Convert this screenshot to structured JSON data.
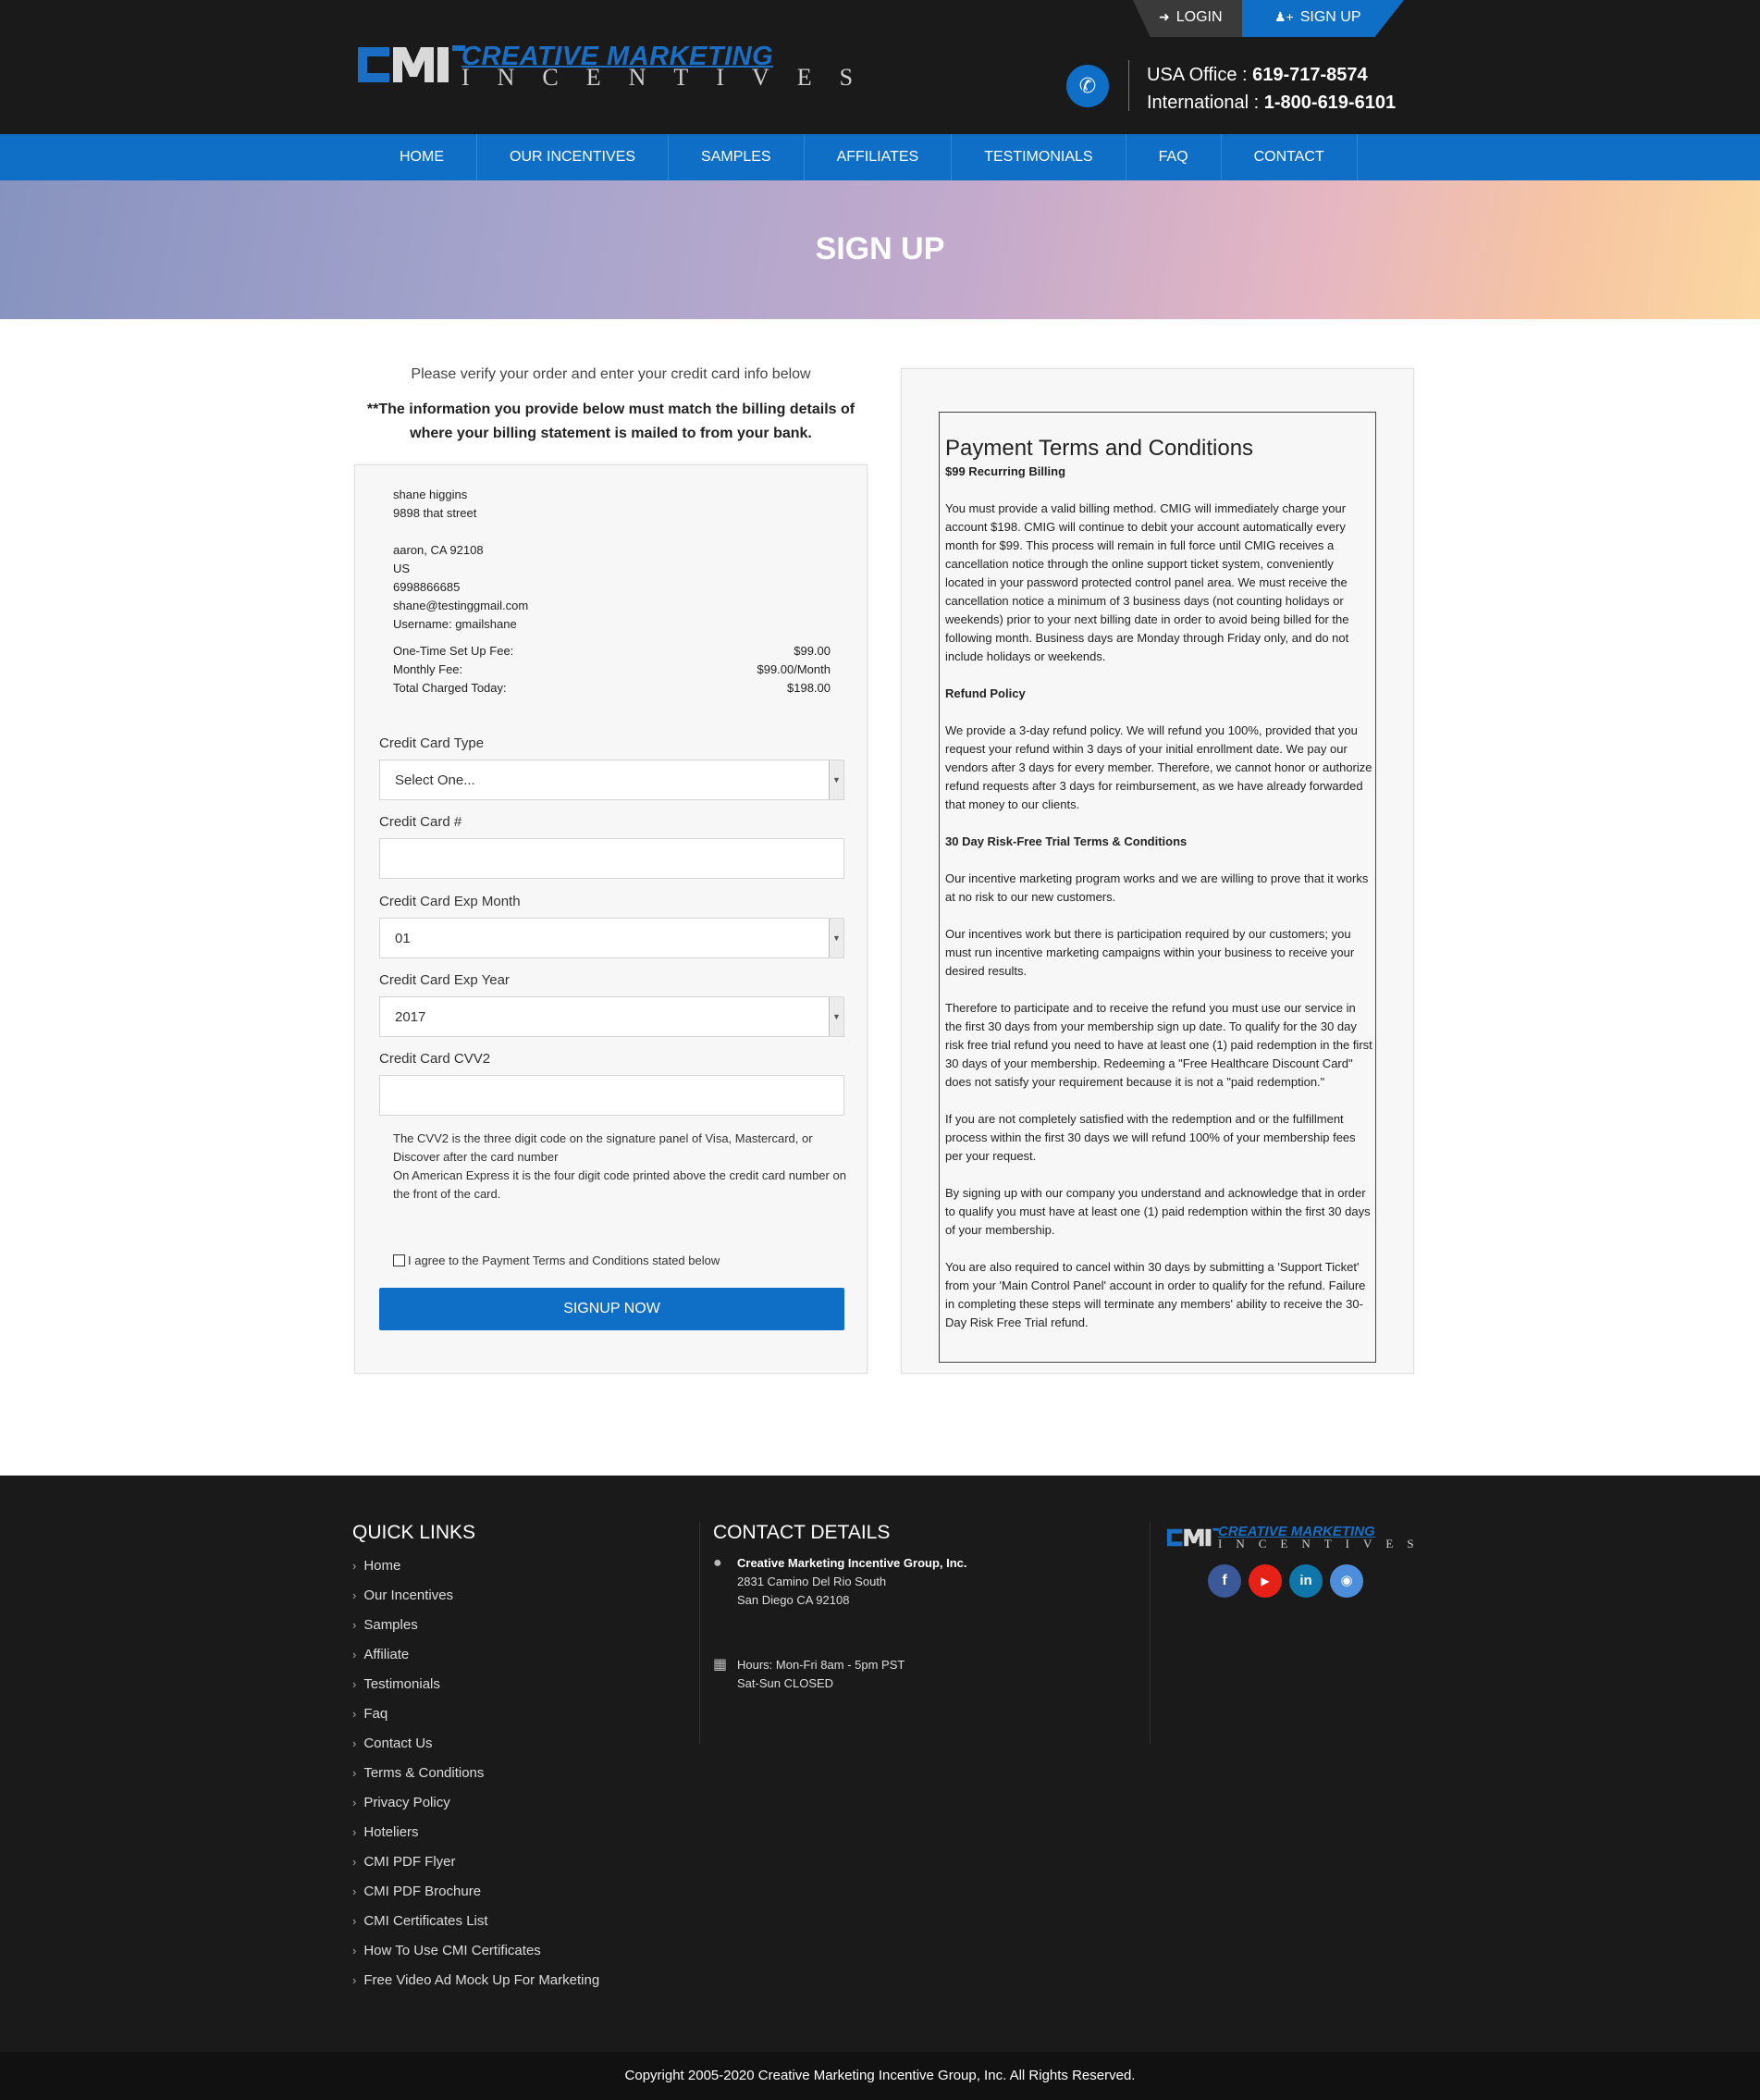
{
  "header": {
    "logo_line1": "CREATIVE MARKETING",
    "logo_line2": "INCENTIVES",
    "login": "LOGIN",
    "signup": "SIGN UP",
    "usa_label": "USA Office : ",
    "usa_phone": "619-717-8574",
    "intl_label": "International : ",
    "intl_phone": "1-800-619-6101"
  },
  "nav": [
    "HOME",
    "OUR INCENTIVES",
    "SAMPLES",
    "AFFILIATES",
    "TESTIMONIALS",
    "FAQ",
    "CONTACT"
  ],
  "banner": {
    "title": "SIGN UP"
  },
  "intro": {
    "line1": "Please verify your order and enter your credit card info below",
    "line2": "**The information you provide below must match the billing details of where your billing statement is mailed to from your bank."
  },
  "order": {
    "name": "shane higgins",
    "street": "9898 that street",
    "city": "aaron, CA 92108",
    "country": "US",
    "phone": "6998866685",
    "email": "shane@testinggmail.com",
    "username": "Username: gmailshane",
    "fees": [
      {
        "label": "One-Time Set Up Fee:",
        "value": "$99.00"
      },
      {
        "label": "Monthly Fee:",
        "value": "$99.00/Month"
      },
      {
        "label": "Total Charged Today:",
        "value": "$198.00"
      }
    ]
  },
  "form": {
    "cc_type_label": "Credit Card Type",
    "cc_type_value": "Select One...",
    "cc_number_label": "Credit Card #",
    "cc_number_value": "",
    "exp_month_label": "Credit Card Exp Month",
    "exp_month_value": "01",
    "exp_year_label": "Credit Card Exp Year",
    "exp_year_value": "2017",
    "cvv_label": "Credit Card CVV2",
    "cvv_value": "",
    "cvv_help1": "The CVV2 is the three digit code on the signature panel of Visa, Mastercard, or Discover after the card number",
    "cvv_help2": "On American Express it is the four digit code printed above the credit card number on the front of the card.",
    "agree": "I agree to the Payment Terms and Conditions stated below",
    "submit": "SIGNUP NOW"
  },
  "terms": {
    "title": "Payment Terms and Conditions",
    "h1": "$99 Recurring Billing",
    "p1": "You must provide a valid billing method. CMIG will immediately charge your account $198. CMIG will continue to debit your account automatically every month for $99. This process will remain in full force until CMIG receives a cancellation notice through the online support ticket system, conveniently located in your password protected control panel area. We must receive the cancellation notice a minimum of 3 business days (not counting holidays or weekends) prior to your next billing date in order to avoid being billed for the following month. Business days are Monday through Friday only, and do not include holidays or weekends.",
    "h2": "Refund Policy",
    "p2": "We provide a 3-day refund policy. We will refund you 100%, provided that you request your refund within 3 days of your initial enrollment date. We pay our vendors after 3 days for every member. Therefore, we cannot honor or authorize refund requests after 3 days for reimbursement, as we have already forwarded that money to our clients.",
    "h3": "30 Day Risk-Free Trial Terms & Conditions",
    "p3": "Our incentive marketing program works and we are willing to prove that it works at no risk to our new customers.",
    "p4": "Our incentives work but there is participation required by our customers; you must run incentive marketing campaigns within your business to receive your desired results.",
    "p5": "Therefore to participate and to receive the refund you must use our service in the first 30 days from your membership sign up date. To qualify for the 30 day risk free trial refund you need to have at least one (1) paid redemption in the first 30 days of your membership. Redeeming a \"Free Healthcare Discount Card\" does not satisfy your requirement because it is not a \"paid redemption.\"",
    "p6": "If you are not completely satisfied with the redemption and or the fulfillment process within the first 30 days we will refund 100% of your membership fees per your request.",
    "p7": "By signing up with our company you understand and acknowledge that in order to qualify you must have at least one (1) paid redemption within the first 30 days of your membership.",
    "p8": "You are also required to cancel within 30 days by submitting a 'Support Ticket' from your 'Main Control Panel' account in order to qualify for the refund. Failure in completing these steps will terminate any members' ability to receive the 30-Day Risk Free Trial refund."
  },
  "footer": {
    "quick_links_title": "QUICK LINKS",
    "quick_links": [
      "Home",
      "Our Incentives",
      "Samples",
      "Affiliate",
      "Testimonials",
      "Faq",
      "Contact Us",
      "Terms & Conditions",
      "Privacy Policy",
      "Hoteliers",
      "CMI PDF Flyer",
      "CMI PDF Brochure",
      "CMI Certificates List",
      "How To Use CMI Certificates",
      "Free Video Ad Mock Up For Marketing"
    ],
    "contact_title": "CONTACT DETAILS",
    "company": "Creative Marketing Incentive Group, Inc.",
    "address1": "2831 Camino Del Rio South",
    "address2": "San Diego CA 92108",
    "hours1": "Hours: Mon-Fri 8am - 5pm PST",
    "hours2": "Sat-Sun CLOSED",
    "copyright": "Copyright 2005-2020 Creative Marketing Incentive Group, Inc. All Rights Reserved."
  },
  "colors": {
    "brand_blue": "#0f6fc6",
    "dark_bg": "#1a1a1a"
  },
  "icons": [
    "login-icon",
    "user-plus-icon",
    "phone-icon",
    "chevron-right-icon",
    "map-marker-icon",
    "calendar-icon",
    "facebook-icon",
    "youtube-icon",
    "linkedin-icon",
    "instagram-icon"
  ]
}
